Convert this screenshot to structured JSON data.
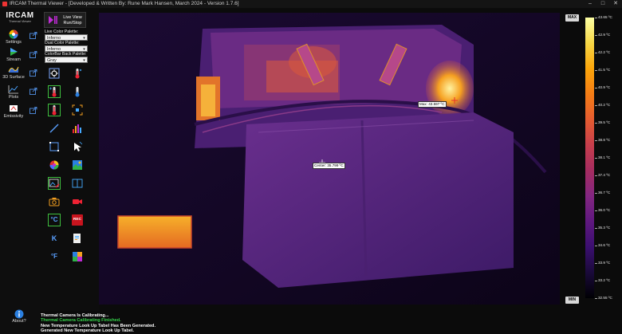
{
  "window": {
    "title": "IRCAM Thermal Viewer - [Developed & Written By: Rune Mark Hansen, March 2024 - Version 1.7.6]",
    "controls": [
      "–",
      "□",
      "✕"
    ]
  },
  "brand": {
    "name": "IRCAM",
    "subtitle": "Thermal Viewer"
  },
  "nav": [
    {
      "label": "Settings",
      "icon": "settings-icon"
    },
    {
      "label": "Stream",
      "icon": "stream-play-icon"
    },
    {
      "label": "3D Surface",
      "icon": "surface-3d-icon"
    },
    {
      "label": "Plots",
      "icon": "plots-icon"
    },
    {
      "label": "Emissivity",
      "icon": "emissivity-icon"
    }
  ],
  "about_label": "About?",
  "live_view": {
    "label_line1": "Live View",
    "label_line2": "Run/Stop"
  },
  "palettes": {
    "live_label": "Live Color Palette:",
    "live_value": "Inferno",
    "dual_label": "Dual Color Palette:",
    "dual_value": "Inferno",
    "back_label": "ColorBar Back Palette:",
    "back_value": "Gray"
  },
  "tools": [
    "focus-crosshair-icon",
    "thermometer-max-icon",
    "thermometer-spot-icon",
    "thermometer-min-icon",
    "thermometer-red-icon",
    "area-select-icon",
    "line-measure-icon",
    "histogram-icon",
    "roi-rectangle-icon",
    "pointer-icon",
    "color-wheel-icon",
    "palette-image-icon",
    "image-edit-icon",
    "dual-view-icon",
    "camera-snapshot-icon",
    "video-record-icon",
    "celsius-unit-icon",
    "record-icon",
    "kelvin-unit-icon",
    "export-file-icon",
    "fahrenheit-unit-icon",
    "gallery-icon"
  ],
  "record_text": "REC",
  "unit_glyphs": {
    "celsius": "°C",
    "kelvin": "K",
    "fahrenheit": "°F"
  },
  "markers": {
    "max_label": "Max: 43.597 ºC",
    "center_label": "Center: 35.799 ºC"
  },
  "colorbar": {
    "max_label": "MAX",
    "min_label": "MIN",
    "ticks": [
      "43.65 ºC",
      "42.9 ºC",
      "42.2 ºC",
      "41.5 ºC",
      "40.9 ºC",
      "40.2 ºC",
      "39.5 ºC",
      "38.8 ºC",
      "38.1 ºC",
      "37.4 ºC",
      "36.7 ºC",
      "36.0 ºC",
      "35.3 ºC",
      "34.6 ºC",
      "33.9 ºC",
      "33.2 ºC",
      "32.55 ºC"
    ],
    "colors": [
      "#fcffa4",
      "#f6d746",
      "#fca50a",
      "#f57d15",
      "#e55c30",
      "#c73e4c",
      "#a52c60",
      "#832681",
      "#5f187f",
      "#3b0f70",
      "#1a0a3a",
      "#000004"
    ]
  },
  "log": [
    {
      "text": "Thermal Camera Is Calibrating...",
      "color": "#ffffff"
    },
    {
      "text": "Thermal Camera Calibrating Finished.",
      "color": "#35d24a"
    },
    {
      "text": "New Temperature Look Up Tabel Has Been Generated.",
      "color": "#ffffff"
    },
    {
      "text": "Generated New Temperature Look Up Tabel.",
      "color": "#ffffff"
    }
  ]
}
